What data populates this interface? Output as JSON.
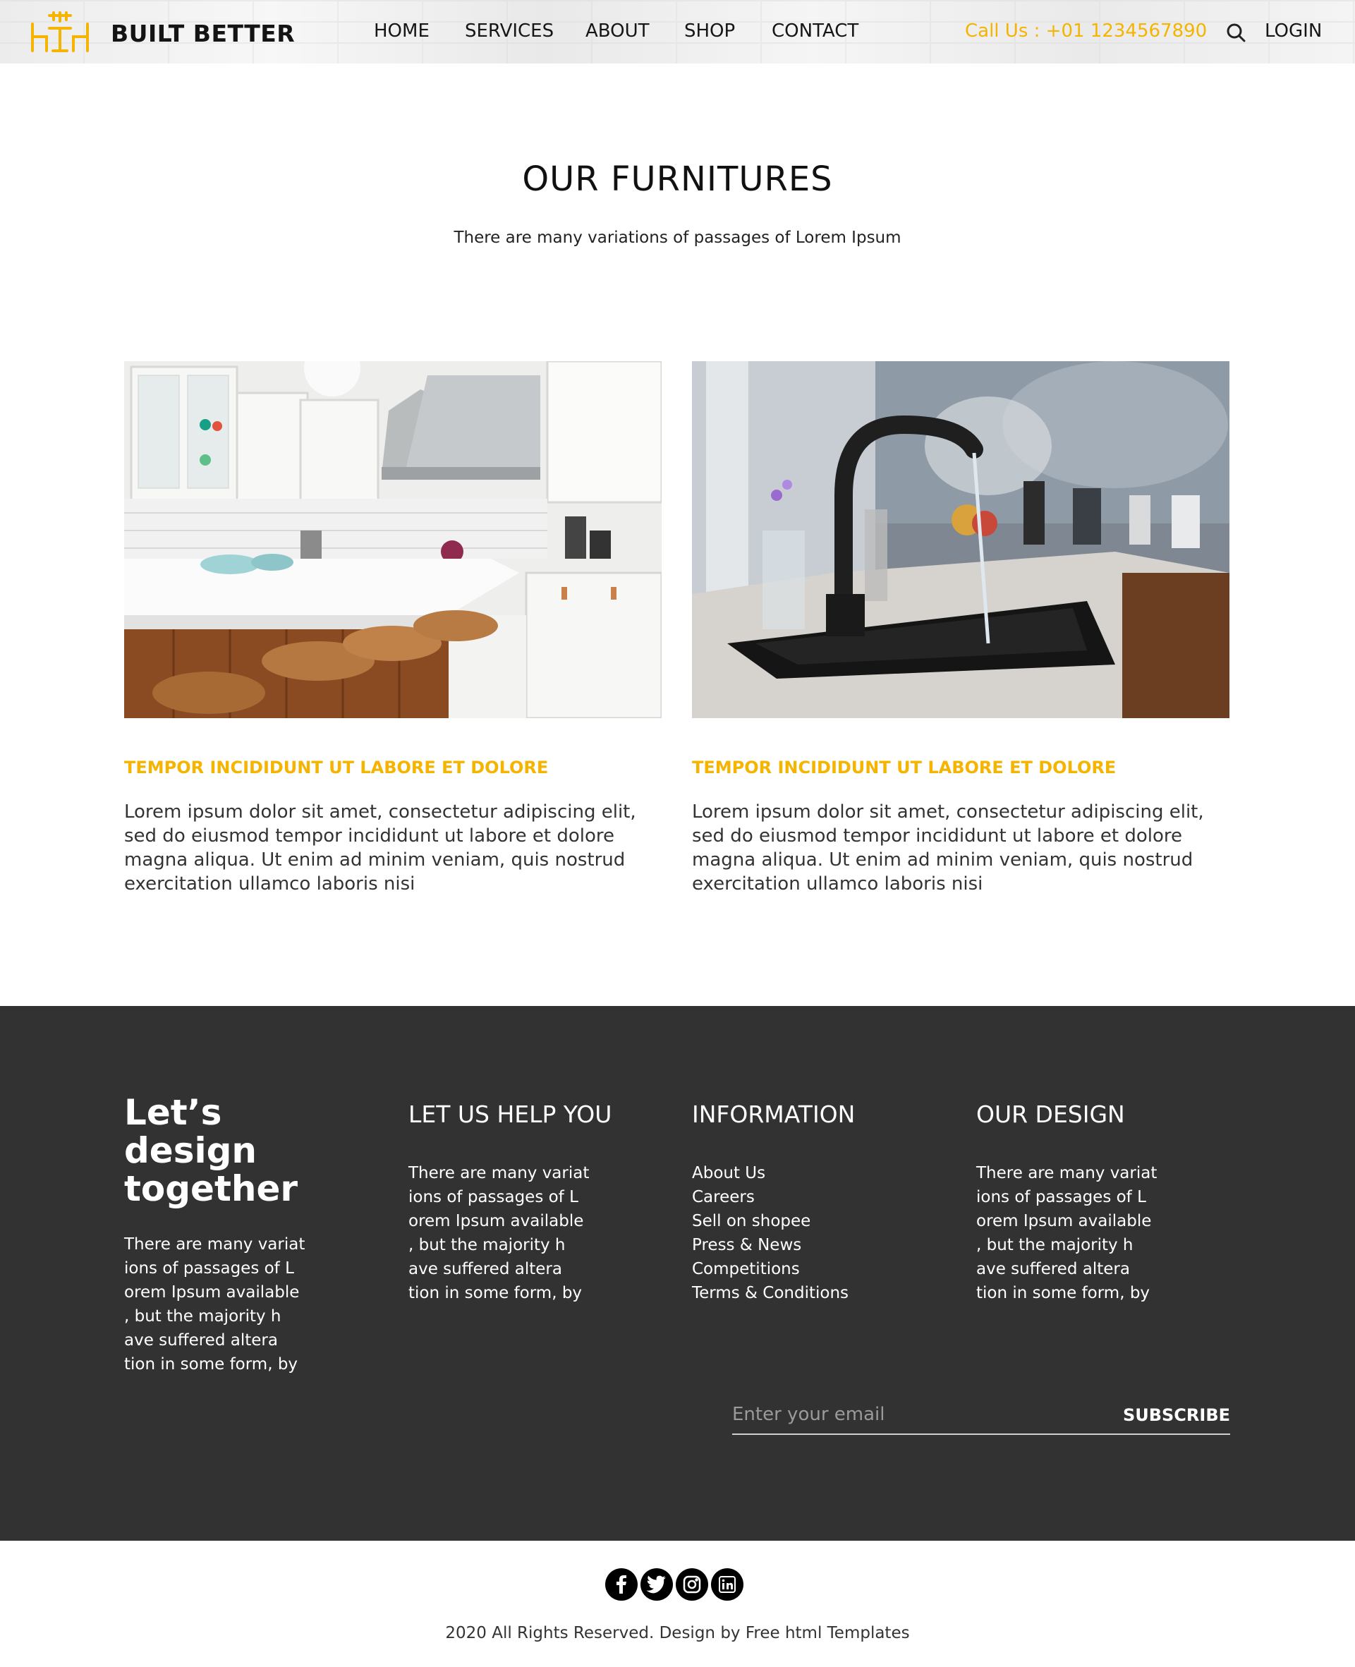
{
  "header": {
    "brand": "BUILT BETTER",
    "nav": [
      "HOME",
      "SERVICES",
      "ABOUT",
      "SHOP",
      "CONTACT"
    ],
    "call": "Call Us : +01 1234567890",
    "login": "LOGIN"
  },
  "furniture": {
    "title": "OUR FURNITURES",
    "subtitle": "There are many variations of passages of Lorem Ipsum",
    "cards": [
      {
        "title": "TEMPOR INCIDIDUNT UT LABORE ET DOLORE",
        "text": "Lorem ipsum dolor sit amet, consectetur adipiscing elit, sed do eiusmod tempor incididunt ut labore et dolore magna aliqua. Ut enim ad minim veniam, quis nostrud exercitation ullamco laboris nisi"
      },
      {
        "title": "TEMPOR INCIDIDUNT UT LABORE ET DOLORE",
        "text": "Lorem ipsum dolor sit amet, consectetur adipiscing elit, sed do eiusmod tempor incididunt ut labore et dolore magna aliqua. Ut enim ad minim veniam, quis nostrud exercitation ullamco laboris nisi"
      }
    ]
  },
  "footer": {
    "col1": {
      "heading": "Let’s design together",
      "text": "There are many variat ions of passages of L orem Ipsum available , but the majority h ave suffered altera tion in some form, by"
    },
    "col2": {
      "heading": "LET US HELP YOU",
      "text": "There are many variat ions of passages of L orem Ipsum available , but the majority h ave suffered altera tion in some form, by"
    },
    "col3": {
      "heading": "INFORMATION",
      "links": [
        "About Us",
        "Careers",
        "Sell on shopee",
        "Press & News",
        "Competitions",
        "Terms & Conditions"
      ]
    },
    "col4": {
      "heading": "OUR DESIGN",
      "text": "There are many variat ions of passages of L orem Ipsum available , but the majority h ave suffered altera tion in some form, by"
    },
    "email_placeholder": "Enter your email",
    "subscribe_label": "SUBSCRIBE"
  },
  "bottom": {
    "socials": [
      "facebook-icon",
      "twitter-icon",
      "instagram-icon",
      "linkedin-icon"
    ],
    "copyright": "2020 All Rights Reserved. Design by Free html Templates"
  },
  "colors": {
    "accent": "#f5b400",
    "footer_bg": "#323232"
  }
}
